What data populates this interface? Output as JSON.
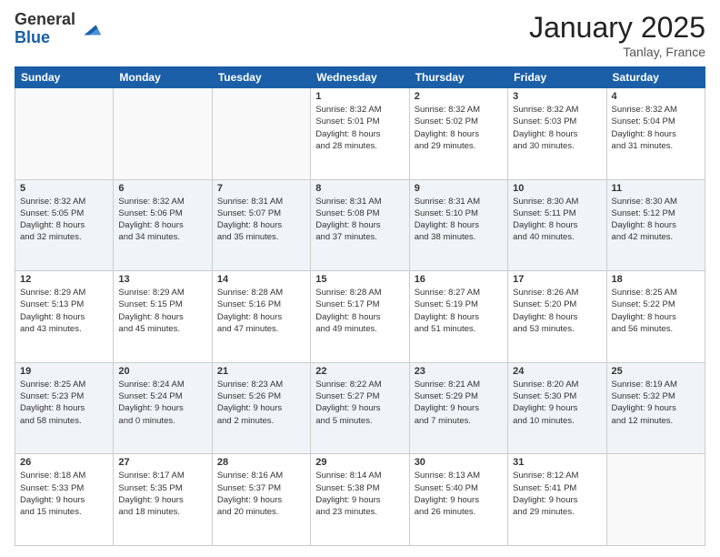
{
  "logo": {
    "general": "General",
    "blue": "Blue"
  },
  "header": {
    "month": "January 2025",
    "location": "Tanlay, France"
  },
  "weekdays": [
    "Sunday",
    "Monday",
    "Tuesday",
    "Wednesday",
    "Thursday",
    "Friday",
    "Saturday"
  ],
  "weeks": [
    [
      {
        "day": "",
        "info": ""
      },
      {
        "day": "",
        "info": ""
      },
      {
        "day": "",
        "info": ""
      },
      {
        "day": "1",
        "info": "Sunrise: 8:32 AM\nSunset: 5:01 PM\nDaylight: 8 hours\nand 28 minutes."
      },
      {
        "day": "2",
        "info": "Sunrise: 8:32 AM\nSunset: 5:02 PM\nDaylight: 8 hours\nand 29 minutes."
      },
      {
        "day": "3",
        "info": "Sunrise: 8:32 AM\nSunset: 5:03 PM\nDaylight: 8 hours\nand 30 minutes."
      },
      {
        "day": "4",
        "info": "Sunrise: 8:32 AM\nSunset: 5:04 PM\nDaylight: 8 hours\nand 31 minutes."
      }
    ],
    [
      {
        "day": "5",
        "info": "Sunrise: 8:32 AM\nSunset: 5:05 PM\nDaylight: 8 hours\nand 32 minutes."
      },
      {
        "day": "6",
        "info": "Sunrise: 8:32 AM\nSunset: 5:06 PM\nDaylight: 8 hours\nand 34 minutes."
      },
      {
        "day": "7",
        "info": "Sunrise: 8:31 AM\nSunset: 5:07 PM\nDaylight: 8 hours\nand 35 minutes."
      },
      {
        "day": "8",
        "info": "Sunrise: 8:31 AM\nSunset: 5:08 PM\nDaylight: 8 hours\nand 37 minutes."
      },
      {
        "day": "9",
        "info": "Sunrise: 8:31 AM\nSunset: 5:10 PM\nDaylight: 8 hours\nand 38 minutes."
      },
      {
        "day": "10",
        "info": "Sunrise: 8:30 AM\nSunset: 5:11 PM\nDaylight: 8 hours\nand 40 minutes."
      },
      {
        "day": "11",
        "info": "Sunrise: 8:30 AM\nSunset: 5:12 PM\nDaylight: 8 hours\nand 42 minutes."
      }
    ],
    [
      {
        "day": "12",
        "info": "Sunrise: 8:29 AM\nSunset: 5:13 PM\nDaylight: 8 hours\nand 43 minutes."
      },
      {
        "day": "13",
        "info": "Sunrise: 8:29 AM\nSunset: 5:15 PM\nDaylight: 8 hours\nand 45 minutes."
      },
      {
        "day": "14",
        "info": "Sunrise: 8:28 AM\nSunset: 5:16 PM\nDaylight: 8 hours\nand 47 minutes."
      },
      {
        "day": "15",
        "info": "Sunrise: 8:28 AM\nSunset: 5:17 PM\nDaylight: 8 hours\nand 49 minutes."
      },
      {
        "day": "16",
        "info": "Sunrise: 8:27 AM\nSunset: 5:19 PM\nDaylight: 8 hours\nand 51 minutes."
      },
      {
        "day": "17",
        "info": "Sunrise: 8:26 AM\nSunset: 5:20 PM\nDaylight: 8 hours\nand 53 minutes."
      },
      {
        "day": "18",
        "info": "Sunrise: 8:25 AM\nSunset: 5:22 PM\nDaylight: 8 hours\nand 56 minutes."
      }
    ],
    [
      {
        "day": "19",
        "info": "Sunrise: 8:25 AM\nSunset: 5:23 PM\nDaylight: 8 hours\nand 58 minutes."
      },
      {
        "day": "20",
        "info": "Sunrise: 8:24 AM\nSunset: 5:24 PM\nDaylight: 9 hours\nand 0 minutes."
      },
      {
        "day": "21",
        "info": "Sunrise: 8:23 AM\nSunset: 5:26 PM\nDaylight: 9 hours\nand 2 minutes."
      },
      {
        "day": "22",
        "info": "Sunrise: 8:22 AM\nSunset: 5:27 PM\nDaylight: 9 hours\nand 5 minutes."
      },
      {
        "day": "23",
        "info": "Sunrise: 8:21 AM\nSunset: 5:29 PM\nDaylight: 9 hours\nand 7 minutes."
      },
      {
        "day": "24",
        "info": "Sunrise: 8:20 AM\nSunset: 5:30 PM\nDaylight: 9 hours\nand 10 minutes."
      },
      {
        "day": "25",
        "info": "Sunrise: 8:19 AM\nSunset: 5:32 PM\nDaylight: 9 hours\nand 12 minutes."
      }
    ],
    [
      {
        "day": "26",
        "info": "Sunrise: 8:18 AM\nSunset: 5:33 PM\nDaylight: 9 hours\nand 15 minutes."
      },
      {
        "day": "27",
        "info": "Sunrise: 8:17 AM\nSunset: 5:35 PM\nDaylight: 9 hours\nand 18 minutes."
      },
      {
        "day": "28",
        "info": "Sunrise: 8:16 AM\nSunset: 5:37 PM\nDaylight: 9 hours\nand 20 minutes."
      },
      {
        "day": "29",
        "info": "Sunrise: 8:14 AM\nSunset: 5:38 PM\nDaylight: 9 hours\nand 23 minutes."
      },
      {
        "day": "30",
        "info": "Sunrise: 8:13 AM\nSunset: 5:40 PM\nDaylight: 9 hours\nand 26 minutes."
      },
      {
        "day": "31",
        "info": "Sunrise: 8:12 AM\nSunset: 5:41 PM\nDaylight: 9 hours\nand 29 minutes."
      },
      {
        "day": "",
        "info": ""
      }
    ]
  ]
}
